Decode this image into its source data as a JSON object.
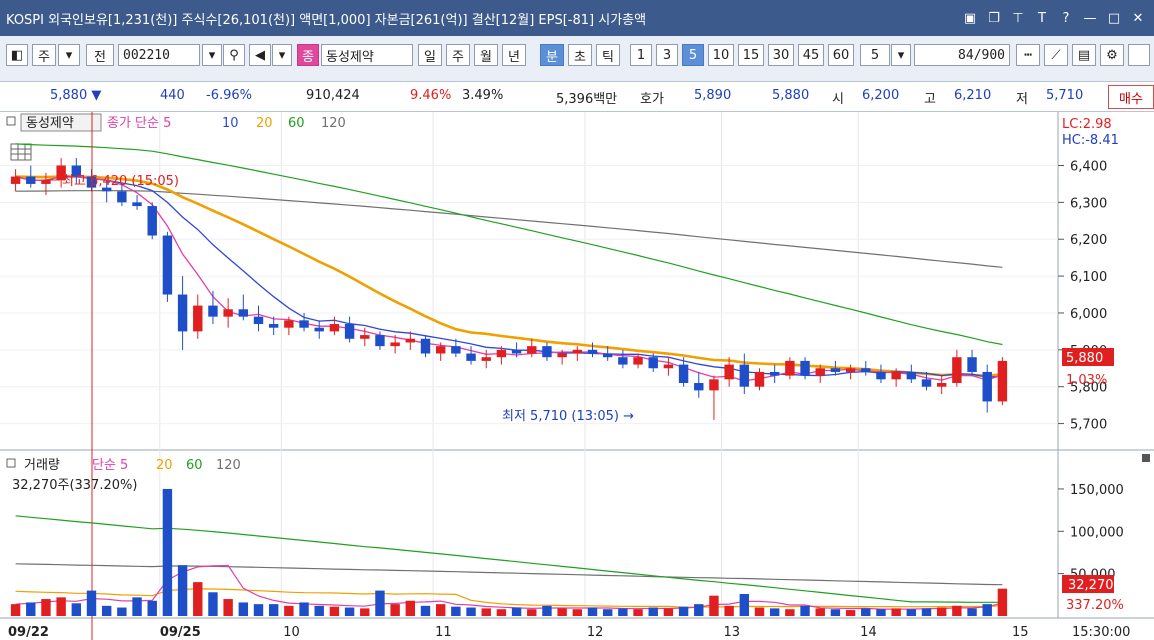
{
  "titlebar": {
    "text": "KOSPI 외국인보유[1,231(천)] 주식수[26,101(천)] 액면[1,000] 자본금[261(억)] 결산[12월] EPS[-81] 시가총액",
    "icons": [
      "layout-icon",
      "window-icon",
      "pin-icon",
      "font-icon",
      "help-icon",
      "minimize-icon",
      "maximize-icon",
      "close-icon"
    ]
  },
  "toolbar": {
    "btn_ju": "주",
    "btn_jeon": "전",
    "code": "002210",
    "badge_jong": "종",
    "stock_name": "동성제약",
    "periods": [
      "일",
      "주",
      "월",
      "년"
    ],
    "intervals": [
      "분",
      "초",
      "틱"
    ],
    "minutes": [
      "1",
      "3",
      "5",
      "10",
      "15",
      "30",
      "45",
      "60"
    ],
    "interval_select": "5",
    "count_display": "84",
    "count_total": "/900"
  },
  "quote": {
    "price": "5,880 ▼",
    "change": "440",
    "change_pct": "-6.96%",
    "volume": "910,424",
    "turnover_pct": "9.46%",
    "other_pct": "3.49%",
    "amount": "5,396백만",
    "ask_label": "호가",
    "ask": "5,890",
    "bid": "5,880",
    "open_label": "시",
    "open": "6,200",
    "high_label": "고",
    "high": "6,210",
    "low_label": "저",
    "low": "5,710",
    "buy_label": "매수"
  },
  "price_panel": {
    "legend_name": "동성제약",
    "legend_label": "종가 단순 5",
    "ma_labels": [
      "10",
      "20",
      "60",
      "120"
    ],
    "lc": "LC:2.98",
    "hc": "HC:-8.41",
    "high_note": "최고 6,420 (15:05)",
    "low_note": "최저 5,710 (13:05) →",
    "current_price_tag": "5,880",
    "current_pct_tag": "1.03%",
    "y_ticks": [
      "6,400",
      "6,300",
      "6,200",
      "6,100",
      "6,000",
      "5,900",
      "5,800",
      "5,700"
    ]
  },
  "volume_panel": {
    "legend_name": "거래량",
    "legend_label": "단순 5",
    "ma_labels": [
      "20",
      "60",
      "120"
    ],
    "readout": "32,270주(337.20%)",
    "current_vol_tag": "32,270",
    "current_pct_tag": "337.20%",
    "y_ticks": [
      "150,000",
      "100,000",
      "50,000"
    ]
  },
  "x_axis": {
    "labels": [
      "09/22",
      "09/25",
      "10",
      "11",
      "12",
      "13",
      "14",
      "15"
    ],
    "time": "15:30:00"
  },
  "colors": {
    "up": "#e02020",
    "down": "#1e4fc8",
    "ma5": "#e040a8",
    "ma10": "#3048d8",
    "ma20": "#f0a000",
    "ma60": "#20a020",
    "ma120": "#707070",
    "titlebar": "#3c5a8c"
  },
  "chart_data": {
    "type": "candlestick",
    "y_range": [
      5650,
      6480
    ],
    "ticks": [
      6400,
      6300,
      6200,
      6100,
      6000,
      5900,
      5800,
      5700
    ],
    "candles": [
      [
        6350,
        6390,
        6330,
        6370
      ],
      [
        6370,
        6400,
        6340,
        6350
      ],
      [
        6350,
        6380,
        6320,
        6360
      ],
      [
        6360,
        6420,
        6340,
        6400
      ],
      [
        6400,
        6420,
        6350,
        6370
      ],
      [
        6370,
        6390,
        6330,
        6340
      ],
      [
        6340,
        6360,
        6300,
        6330
      ],
      [
        6330,
        6350,
        6290,
        6300
      ],
      [
        6300,
        6320,
        6280,
        6290
      ],
      [
        6290,
        6300,
        6200,
        6210
      ],
      [
        6210,
        6220,
        6030,
        6050
      ],
      [
        6050,
        6100,
        5900,
        5950
      ],
      [
        5950,
        6050,
        5930,
        6020
      ],
      [
        6020,
        6060,
        5970,
        5990
      ],
      [
        5990,
        6040,
        5960,
        6010
      ],
      [
        6010,
        6050,
        5980,
        5990
      ],
      [
        5990,
        6020,
        5950,
        5970
      ],
      [
        5970,
        5990,
        5940,
        5960
      ],
      [
        5960,
        5990,
        5940,
        5980
      ],
      [
        5980,
        6000,
        5950,
        5960
      ],
      [
        5960,
        5980,
        5930,
        5950
      ],
      [
        5950,
        5990,
        5940,
        5970
      ],
      [
        5970,
        5990,
        5920,
        5930
      ],
      [
        5930,
        5960,
        5910,
        5940
      ],
      [
        5940,
        5950,
        5900,
        5910
      ],
      [
        5910,
        5940,
        5890,
        5920
      ],
      [
        5920,
        5950,
        5900,
        5930
      ],
      [
        5930,
        5940,
        5880,
        5890
      ],
      [
        5890,
        5920,
        5870,
        5910
      ],
      [
        5910,
        5930,
        5880,
        5890
      ],
      [
        5890,
        5910,
        5860,
        5870
      ],
      [
        5870,
        5900,
        5850,
        5880
      ],
      [
        5880,
        5910,
        5860,
        5900
      ],
      [
        5900,
        5920,
        5880,
        5890
      ],
      [
        5890,
        5930,
        5880,
        5910
      ],
      [
        5910,
        5920,
        5870,
        5880
      ],
      [
        5880,
        5900,
        5860,
        5890
      ],
      [
        5890,
        5910,
        5870,
        5900
      ],
      [
        5900,
        5920,
        5880,
        5890
      ],
      [
        5890,
        5910,
        5870,
        5880
      ],
      [
        5880,
        5900,
        5850,
        5860
      ],
      [
        5860,
        5890,
        5850,
        5880
      ],
      [
        5880,
        5890,
        5840,
        5850
      ],
      [
        5850,
        5880,
        5830,
        5860
      ],
      [
        5860,
        5880,
        5800,
        5810
      ],
      [
        5810,
        5840,
        5770,
        5790
      ],
      [
        5790,
        5830,
        5710,
        5820
      ],
      [
        5820,
        5880,
        5800,
        5860
      ],
      [
        5860,
        5890,
        5780,
        5800
      ],
      [
        5800,
        5850,
        5790,
        5840
      ],
      [
        5840,
        5860,
        5810,
        5830
      ],
      [
        5830,
        5880,
        5820,
        5870
      ],
      [
        5870,
        5880,
        5820,
        5830
      ],
      [
        5830,
        5860,
        5810,
        5850
      ],
      [
        5850,
        5870,
        5830,
        5840
      ],
      [
        5840,
        5860,
        5820,
        5850
      ],
      [
        5850,
        5870,
        5830,
        5840
      ],
      [
        5840,
        5860,
        5810,
        5820
      ],
      [
        5820,
        5850,
        5800,
        5840
      ],
      [
        5840,
        5860,
        5810,
        5820
      ],
      [
        5820,
        5840,
        5790,
        5800
      ],
      [
        5800,
        5830,
        5780,
        5810
      ],
      [
        5810,
        5900,
        5800,
        5880
      ],
      [
        5880,
        5900,
        5830,
        5840
      ],
      [
        5840,
        5860,
        5730,
        5760
      ],
      [
        5760,
        5880,
        5750,
        5870
      ]
    ],
    "volumes": [
      14000,
      16000,
      20000,
      22000,
      15000,
      30000,
      12000,
      10000,
      22000,
      18000,
      150000,
      60000,
      40000,
      28000,
      20000,
      16000,
      14000,
      14000,
      12000,
      16000,
      12000,
      11000,
      10000,
      9000,
      30000,
      14000,
      18000,
      12000,
      14000,
      11000,
      10000,
      9000,
      8000,
      10000,
      8000,
      12000,
      9000,
      8000,
      10000,
      8000,
      9000,
      8000,
      10000,
      9000,
      11000,
      14000,
      24000,
      12000,
      26000,
      10000,
      9000,
      8000,
      12000,
      9000,
      8000,
      7000,
      9000,
      8000,
      9000,
      8000,
      9000,
      10000,
      12000,
      9000,
      14000,
      32270
    ]
  }
}
